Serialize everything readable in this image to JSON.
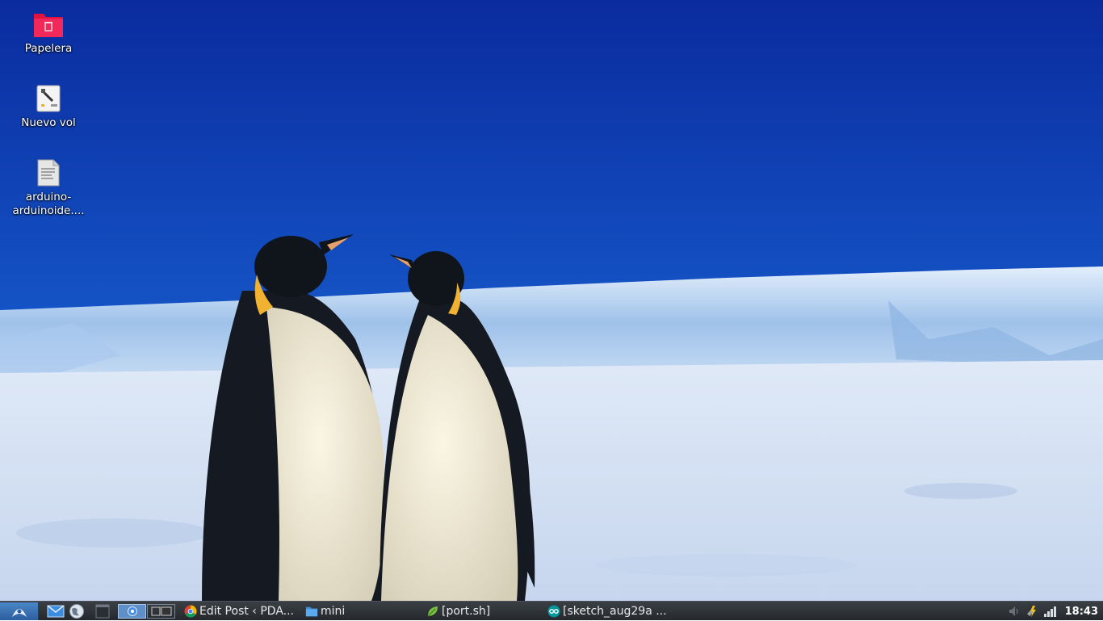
{
  "desktop": {
    "icons": [
      {
        "label": "Papelera",
        "icon": "trash-folder-icon"
      },
      {
        "label": "Nuevo vol",
        "icon": "usb-drive-icon"
      },
      {
        "label": "arduino-arduinoide....",
        "icon": "text-file-icon"
      }
    ],
    "wallpaper": "penguins-antarctica"
  },
  "taskbar": {
    "tasks": [
      {
        "label": "Edit Post ‹ PDA...",
        "icon": "chrome-icon"
      },
      {
        "label": "mini",
        "icon": "folder-icon"
      },
      {
        "label": "[port.sh]",
        "icon": "leafpad-icon"
      },
      {
        "label": "[sketch_aug29a ...",
        "icon": "arduino-icon"
      }
    ],
    "clock": "18:43"
  },
  "colors": {
    "sky_top": "#0a2fa8",
    "sky_bottom": "#2a7ee0",
    "taskbar": "#2d3238",
    "start": "#3a74b8"
  }
}
